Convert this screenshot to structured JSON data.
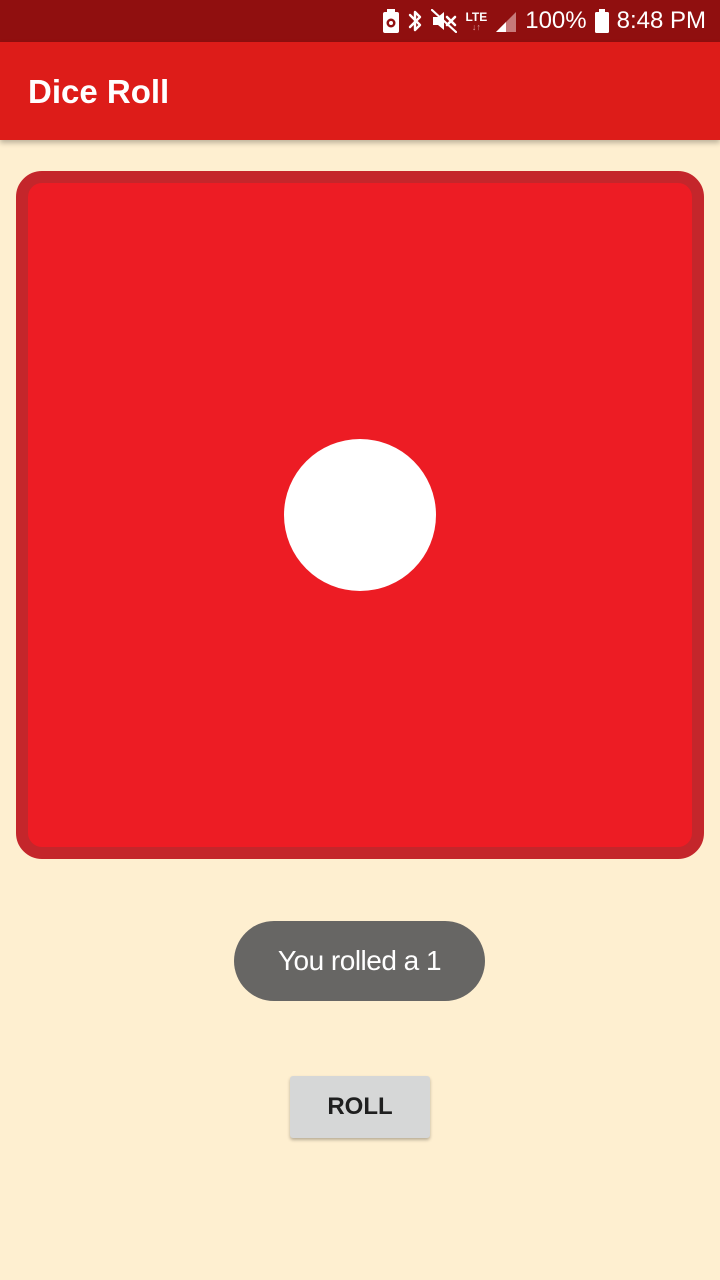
{
  "status_bar": {
    "icons": [
      "battery-saver-icon",
      "bluetooth-icon",
      "vibrate-icon",
      "lte-icon",
      "cell-signal-icon",
      "battery-icon"
    ],
    "lte_label": "LTE",
    "lte_arrows": "↓↑",
    "battery_percent": "100%",
    "time": "8:48 PM"
  },
  "app_bar": {
    "title": "Dice Roll",
    "color": "#DD1C19"
  },
  "die": {
    "value": 1,
    "face_color": "#ED1C24",
    "border_color": "#C4262B",
    "pip_color": "#FFFFFF"
  },
  "toast": {
    "message": "You rolled a 1"
  },
  "roll_button": {
    "label": "ROLL"
  },
  "colors": {
    "background": "#FEEFD0",
    "status_bar": "#900F0F"
  }
}
